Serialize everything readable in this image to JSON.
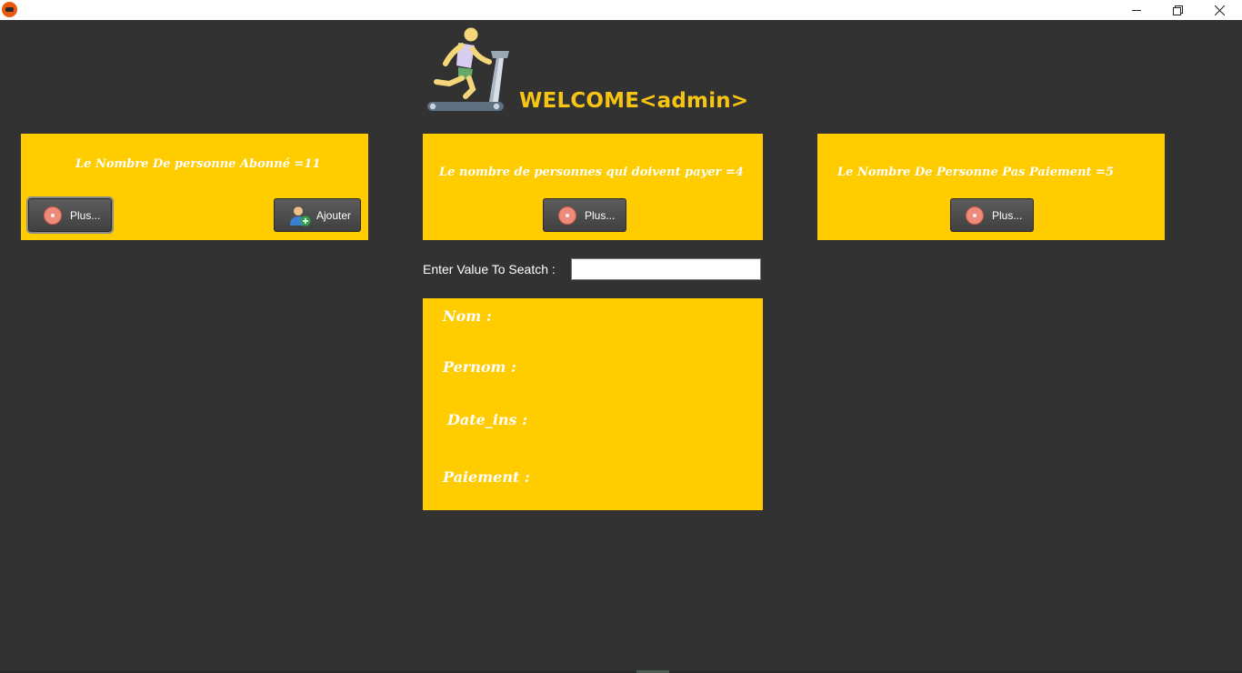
{
  "window": {
    "icons": {
      "app": "app-logo-icon",
      "minimize": "minimize-icon",
      "maximize": "restore-icon",
      "close": "close-icon"
    }
  },
  "header": {
    "welcome": "WELCOME<admin>",
    "hero_icon": "treadmill-runner-icon"
  },
  "cards": [
    {
      "text": "Le Nombre De personne Abonné =11",
      "buttons": [
        {
          "label": "Plus...",
          "icon": "disc-icon"
        },
        {
          "label": "Ajouter",
          "icon": "add-user-icon"
        }
      ]
    },
    {
      "text": "Le nombre de personnes qui doivent payer =4",
      "buttons": [
        {
          "label": "Plus...",
          "icon": "disc-icon"
        }
      ]
    },
    {
      "text": "Le Nombre De Personne Pas Paiement =5",
      "buttons": [
        {
          "label": "Plus...",
          "icon": "disc-icon"
        }
      ]
    }
  ],
  "search": {
    "label": "Enter Value To Seatch :",
    "value": ""
  },
  "details": {
    "nom": "Nom :",
    "prenom": "Pernom :",
    "date_ins": "Date_ins :",
    "paiement": "Paiement :"
  },
  "colors": {
    "background": "#323232",
    "accent": "#ffcc00",
    "welcome_text": "#f6c513",
    "button": "#4a4a4a"
  }
}
